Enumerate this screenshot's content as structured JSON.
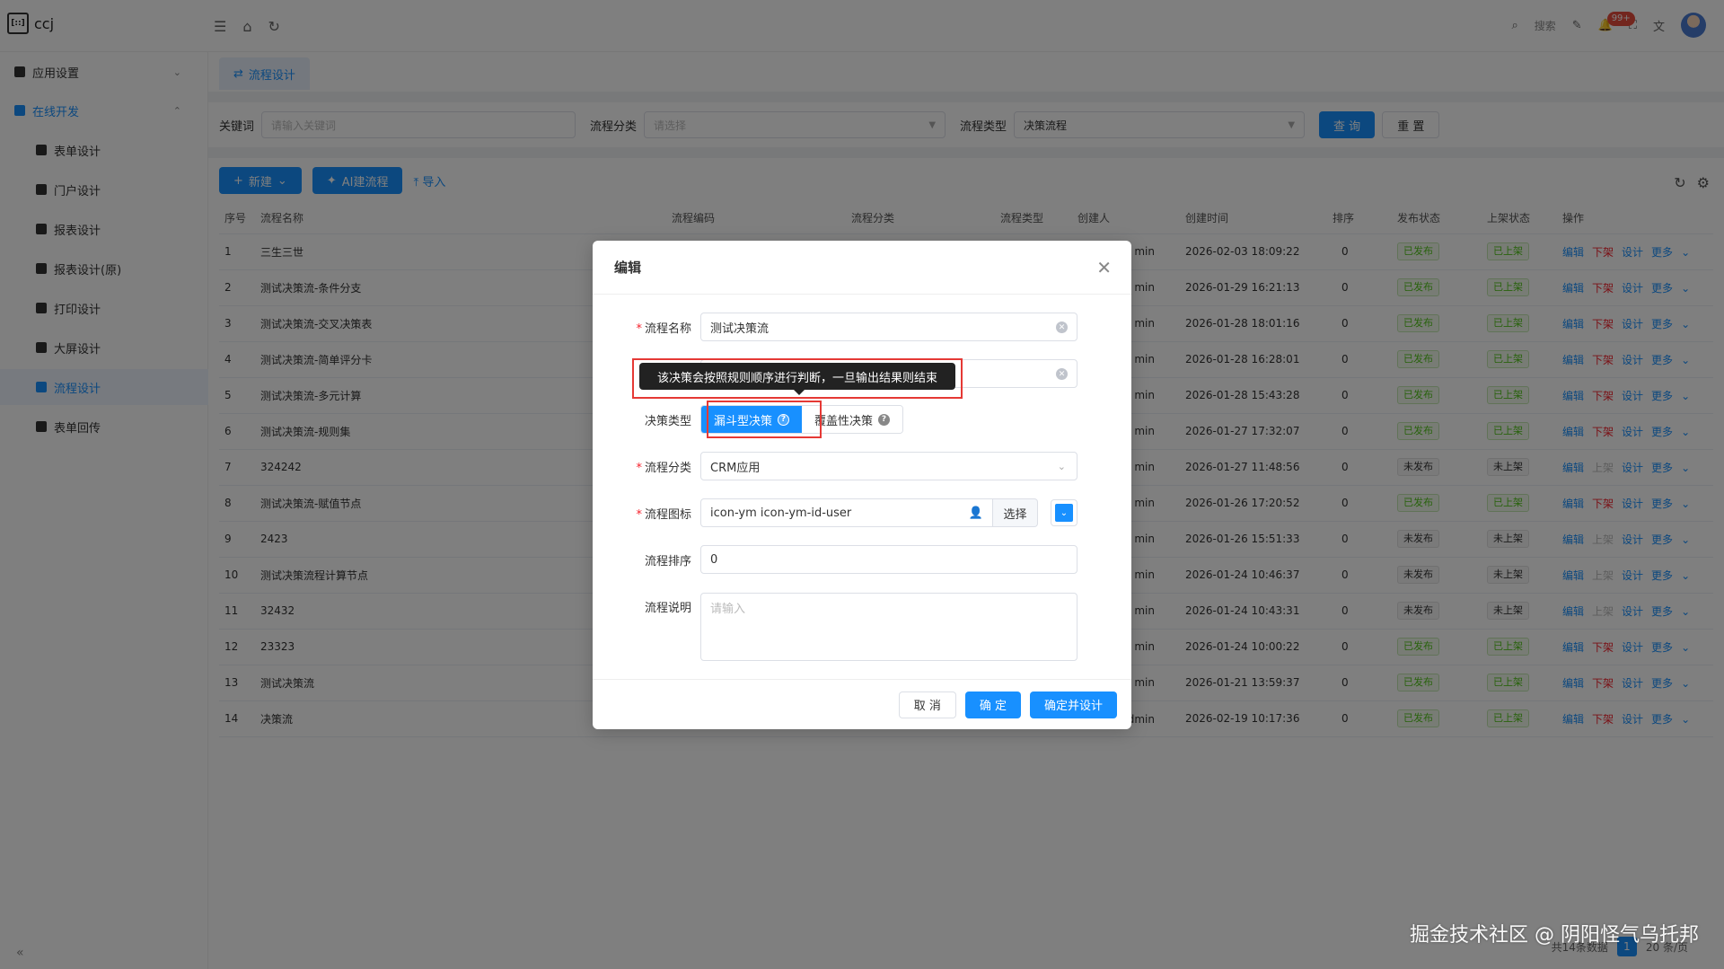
{
  "app": {
    "name": "ccj",
    "logo_text": "[::]"
  },
  "topbar": {
    "search_label": "搜索",
    "notification_count": "99+"
  },
  "sidebar": {
    "groups": [
      {
        "label": "应用设置",
        "expanded": false
      },
      {
        "label": "在线开发",
        "expanded": true
      }
    ],
    "items": [
      {
        "label": "表单设计"
      },
      {
        "label": "门户设计"
      },
      {
        "label": "报表设计"
      },
      {
        "label": "报表设计(原)"
      },
      {
        "label": "打印设计"
      },
      {
        "label": "大屏设计"
      },
      {
        "label": "流程设计",
        "active": true
      },
      {
        "label": "表单回传"
      }
    ]
  },
  "tab": {
    "label": "流程设计"
  },
  "filters": {
    "keyword_label": "关键词",
    "keyword_placeholder": "请输入关键词",
    "category_label": "流程分类",
    "category_placeholder": "请选择",
    "type_label": "流程类型",
    "type_value": "决策流程",
    "search_button": "查 询",
    "reset_button": "重 置"
  },
  "toolbar": {
    "new_button": "新建",
    "ai_button": "AI建流程",
    "import_button": "导入"
  },
  "table": {
    "headers": [
      "序号",
      "流程名称",
      "流程编码",
      "流程分类",
      "流程类型",
      "创建人",
      "创建时间",
      "排序",
      "发布状态",
      "上架状态",
      "操作"
    ],
    "rows": [
      {
        "no": "1",
        "name": "三生三世",
        "creator": "min",
        "time": "2026-02-03 18:09:22",
        "sort": "0",
        "pub": "已发布",
        "shelf": "已上架",
        "pub_ok": true
      },
      {
        "no": "2",
        "name": "测试决策流-条件分支",
        "creator": "min",
        "time": "2026-01-29 16:21:13",
        "sort": "0",
        "pub": "已发布",
        "shelf": "已上架",
        "pub_ok": true
      },
      {
        "no": "3",
        "name": "测试决策流-交叉决策表",
        "creator": "min",
        "time": "2026-01-28 18:01:16",
        "sort": "0",
        "pub": "已发布",
        "shelf": "已上架",
        "pub_ok": true
      },
      {
        "no": "4",
        "name": "测试决策流-简单评分卡",
        "creator": "min",
        "time": "2026-01-28 16:28:01",
        "sort": "0",
        "pub": "已发布",
        "shelf": "已上架",
        "pub_ok": true
      },
      {
        "no": "5",
        "name": "测试决策流-多元计算",
        "creator": "min",
        "time": "2026-01-28 15:43:28",
        "sort": "0",
        "pub": "已发布",
        "shelf": "已上架",
        "pub_ok": true
      },
      {
        "no": "6",
        "name": "测试决策流-规则集",
        "creator": "min",
        "time": "2026-01-27 17:32:07",
        "sort": "0",
        "pub": "已发布",
        "shelf": "已上架",
        "pub_ok": true
      },
      {
        "no": "7",
        "name": "324242",
        "creator": "min",
        "time": "2026-01-27 11:48:56",
        "sort": "0",
        "pub": "未发布",
        "shelf": "未上架",
        "pub_ok": false
      },
      {
        "no": "8",
        "name": "测试决策流-赋值节点",
        "creator": "min",
        "time": "2026-01-26 17:20:52",
        "sort": "0",
        "pub": "已发布",
        "shelf": "已上架",
        "pub_ok": true
      },
      {
        "no": "9",
        "name": "2423",
        "creator": "min",
        "time": "2026-01-26 15:51:33",
        "sort": "0",
        "pub": "未发布",
        "shelf": "未上架",
        "pub_ok": false
      },
      {
        "no": "10",
        "name": "测试决策流程计算节点",
        "creator": "min",
        "time": "2026-01-24 10:46:37",
        "sort": "0",
        "pub": "未发布",
        "shelf": "未上架",
        "pub_ok": false
      },
      {
        "no": "11",
        "name": "32432",
        "creator": "min",
        "time": "2026-01-24 10:43:31",
        "sort": "0",
        "pub": "未发布",
        "shelf": "未上架",
        "pub_ok": false
      },
      {
        "no": "12",
        "name": "23323",
        "creator": "min",
        "time": "2026-01-24 10:00:22",
        "sort": "0",
        "pub": "已发布",
        "shelf": "已上架",
        "pub_ok": true
      },
      {
        "no": "13",
        "name": "测试决策流",
        "creator": "min",
        "time": "2026-01-21 13:59:37",
        "sort": "0",
        "pub": "已发布",
        "shelf": "已上架",
        "pub_ok": true
      },
      {
        "no": "14",
        "name": "决策流",
        "creator": "管理员/admin",
        "time": "2026-02-19 10:17:36",
        "sort": "0",
        "pub": "已发布",
        "shelf": "已上架",
        "pub_ok": true
      }
    ],
    "ops": {
      "edit": "编辑",
      "down": "下架",
      "up": "上架",
      "design": "设计",
      "more": "更多"
    }
  },
  "pager": {
    "total": "共14条数据",
    "current": "1",
    "per_page": "20 条/页"
  },
  "dialog": {
    "title": "编辑",
    "name_label": "流程名称",
    "name_value": "测试决策流",
    "tooltip": "该决策会按照规则顺序进行判断，一旦输出结果则结束",
    "decision_type_label": "决策类型",
    "decision_a": "漏斗型决策",
    "decision_b": "覆盖性决策",
    "category_label": "流程分类",
    "category_value": "CRM应用",
    "icon_label": "流程图标",
    "icon_value": "icon-ym icon-ym-id-user",
    "icon_select": "选择",
    "sort_label": "流程排序",
    "sort_value": "0",
    "desc_label": "流程说明",
    "desc_placeholder": "请输入",
    "cancel": "取 消",
    "ok": "确 定",
    "ok_design": "确定并设计",
    "accent": "#1890ff"
  },
  "watermark": "掘金技术社区 @ 阴阳怪气乌托邦"
}
